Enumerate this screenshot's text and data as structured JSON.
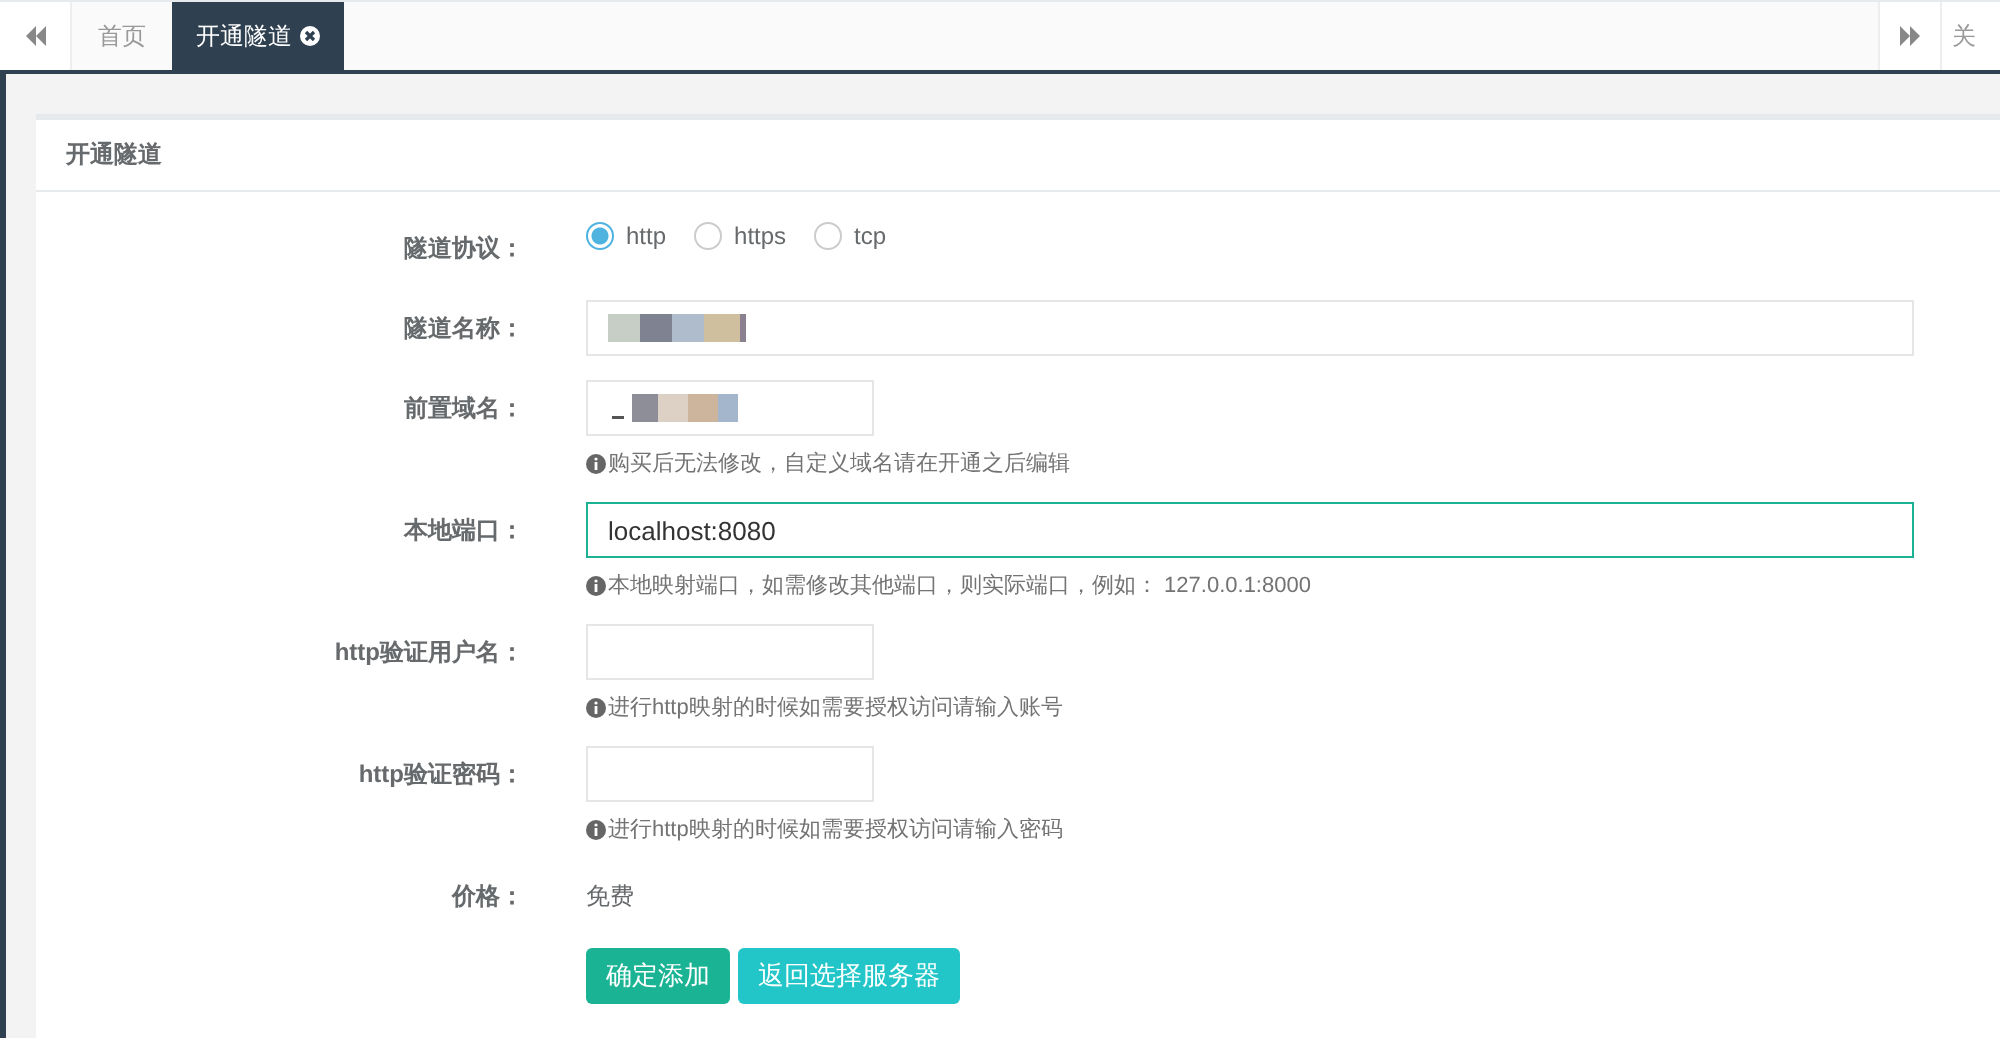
{
  "tabbar": {
    "tabs": [
      {
        "label": "首页",
        "selected": false,
        "closable": false
      },
      {
        "label": "开通隧道",
        "selected": true,
        "closable": true
      }
    ],
    "close_menu": "关"
  },
  "card": {
    "title": "开通隧道",
    "fields": [
      {
        "kind": "radio",
        "label": "隧道协议：",
        "options": [
          {
            "label": "http",
            "selected": true
          },
          {
            "label": "https",
            "selected": false
          },
          {
            "label": "tcp",
            "selected": false
          }
        ]
      },
      {
        "kind": "longfield",
        "label": "隧道名称：",
        "redacted": true,
        "focused": false
      },
      {
        "kind": "shortfield",
        "label": "前置域名：",
        "redacted": true,
        "focused": false,
        "help": "购买后无法修改，自定义域名请在开通之后编辑"
      },
      {
        "kind": "longfield",
        "label": "本地端口：",
        "value": "localhost:8080",
        "focused": true,
        "help": "本地映射端口，如需修改其他端口，则实际端口，例如： 127.0.0.1:8000"
      },
      {
        "kind": "shortfield",
        "label": "http验证用户名：",
        "focused": false,
        "help": "进行http映射的时候如需要授权访问请输入账号"
      },
      {
        "kind": "shortfield",
        "label": "http验证密码：",
        "focused": false,
        "help": "进行http映射的时候如需要授权访问请输入密码"
      },
      {
        "kind": "text",
        "label": "价格：",
        "value": "免费"
      }
    ],
    "buttons": [
      {
        "label": "确定添加",
        "kind": "primary"
      },
      {
        "label": "返回选择服务器",
        "kind": "info"
      }
    ]
  }
}
